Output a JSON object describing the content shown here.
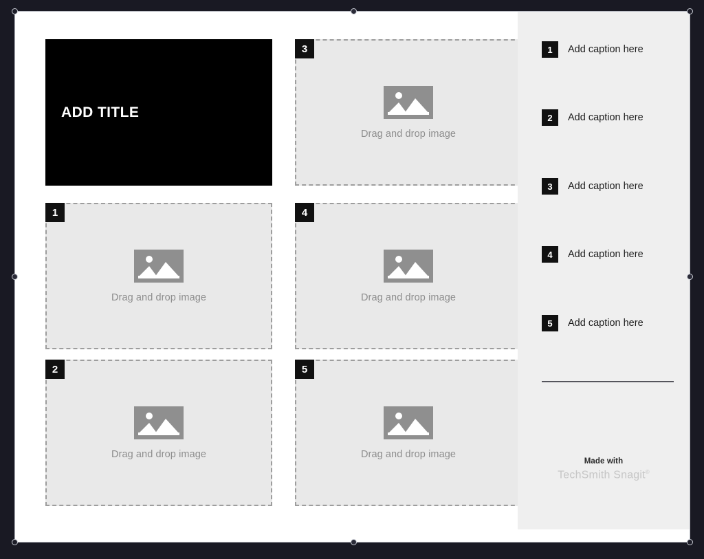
{
  "canvas": {
    "background_color": "#ffffff",
    "stage_background_color": "#191923"
  },
  "title_block": {
    "text": "ADD TITLE",
    "background_color": "#000000",
    "text_color": "#ffffff"
  },
  "image_slots": [
    {
      "badge": "3",
      "placeholder_label": "Drag and drop image",
      "icon": "image-placeholder-icon"
    },
    {
      "badge": "1",
      "placeholder_label": "Drag and drop image",
      "icon": "image-placeholder-icon"
    },
    {
      "badge": "4",
      "placeholder_label": "Drag and drop image",
      "icon": "image-placeholder-icon"
    },
    {
      "badge": "2",
      "placeholder_label": "Drag and drop image",
      "icon": "image-placeholder-icon"
    },
    {
      "badge": "5",
      "placeholder_label": "Drag and drop image",
      "icon": "image-placeholder-icon"
    }
  ],
  "sidebar": {
    "background_color": "#efefef",
    "captions": [
      {
        "badge": "1",
        "text": "Add caption here"
      },
      {
        "badge": "2",
        "text": "Add caption here"
      },
      {
        "badge": "3",
        "text": "Add caption here"
      },
      {
        "badge": "4",
        "text": "Add caption here"
      },
      {
        "badge": "5",
        "text": "Add caption here"
      }
    ],
    "branding": {
      "made_with": "Made with",
      "product": "TechSmith Snagit",
      "trademark": "®"
    }
  },
  "handles": {
    "names": [
      "handle-top-left",
      "handle-top-center",
      "handle-top-right",
      "handle-middle-left",
      "handle-middle-right",
      "handle-bottom-left",
      "handle-bottom-center",
      "handle-bottom-right"
    ]
  }
}
